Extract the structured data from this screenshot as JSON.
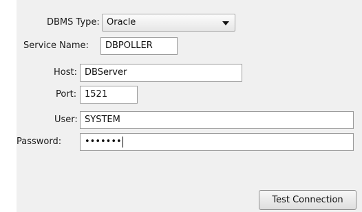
{
  "form": {
    "dbms_type_label": "DBMS Type:",
    "dbms_type_value": "Oracle",
    "service_name_label": "Service Name:",
    "service_name_value": "DBPOLLER",
    "host_label": "Host:",
    "host_value": "DBServer",
    "port_label": "Port:",
    "port_value": "1521",
    "user_label": "User:",
    "user_value": "SYSTEM",
    "password_label": "Password:",
    "password_mask": "•••••••"
  },
  "actions": {
    "test_connection_label": "Test Connection"
  }
}
